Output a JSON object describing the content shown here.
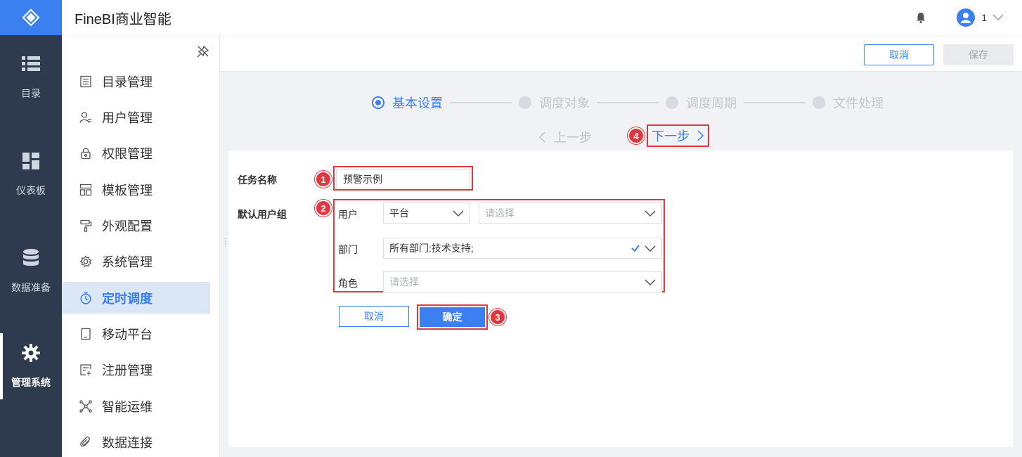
{
  "app": {
    "title": "FineBI商业智能"
  },
  "header": {
    "user_name": "1"
  },
  "rail": {
    "items": [
      {
        "label": "目录",
        "icon": "list-icon"
      },
      {
        "label": "仪表板",
        "icon": "dashboard-icon"
      },
      {
        "label": "数据准备",
        "icon": "database-icon"
      },
      {
        "label": "管理系统",
        "icon": "gear-icon",
        "active": true
      }
    ]
  },
  "menu": {
    "items": [
      {
        "label": "目录管理",
        "icon": "catalog-icon"
      },
      {
        "label": "用户管理",
        "icon": "user-icon"
      },
      {
        "label": "权限管理",
        "icon": "lock-icon"
      },
      {
        "label": "模板管理",
        "icon": "template-icon"
      },
      {
        "label": "外观配置",
        "icon": "paint-roller-icon"
      },
      {
        "label": "系统管理",
        "icon": "gear-icon"
      },
      {
        "label": "定时调度",
        "icon": "timer-icon",
        "active": true
      },
      {
        "label": "移动平台",
        "icon": "tablet-icon"
      },
      {
        "label": "注册管理",
        "icon": "register-icon"
      },
      {
        "label": "智能运维",
        "icon": "network-icon"
      },
      {
        "label": "数据连接",
        "icon": "paperclip-icon"
      }
    ]
  },
  "toolbar": {
    "cancel_label": "取消",
    "save_label": "保存"
  },
  "steps": {
    "items": [
      "基本设置",
      "调度对象",
      "调度周期",
      "文件处理"
    ],
    "active": "基本设置",
    "prev_label": "上一步",
    "next_label": "下一步"
  },
  "form": {
    "task_name_label": "任务名称",
    "task_name_value": "预警示例",
    "default_group_label": "默认用户组",
    "user_label": "用户",
    "user_source": "平台",
    "user_placeholder": "请选择",
    "dept_label": "部门",
    "dept_value": "所有部门:技术支持;",
    "role_label": "角色",
    "role_placeholder": "请选择",
    "cancel_label": "取消",
    "confirm_label": "确定"
  },
  "annotations": [
    "1",
    "2",
    "3",
    "4"
  ],
  "colors": {
    "accent": "#3b7ff0",
    "highlight": "#e0383e",
    "rail": "#2e3a4d"
  }
}
